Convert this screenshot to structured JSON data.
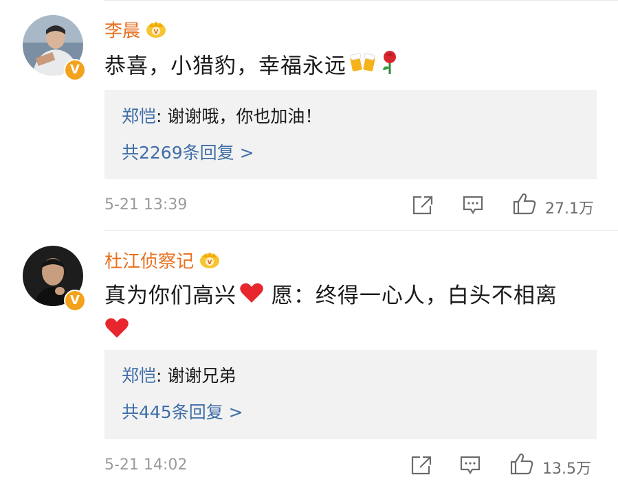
{
  "comments": [
    {
      "username": "李晨",
      "text": "恭喜，小猎豹，幸福永远",
      "emojis": [
        "beer-cheers-icon",
        "rose-icon"
      ],
      "reply": {
        "author": "郑恺",
        "separator": ":",
        "text": " 谢谢哦，你也加油！",
        "count_label": "共2269条回复 >"
      },
      "time": "5-21 13:39",
      "likes": "27.1万"
    },
    {
      "username": "杜江侦察记",
      "text_line1": "真为你们高兴",
      "text_after_heart": " 愿：终得一心人，白头不相离",
      "emojis": [
        "heart-icon",
        "heart-icon"
      ],
      "reply": {
        "author": "郑恺",
        "separator": ":",
        "text": " 谢谢兄弟",
        "count_label": "共445条回复 >"
      },
      "time": "5-21 14:02",
      "likes": "13.5万"
    }
  ],
  "colors": {
    "username": "#e96f1e",
    "reply_author": "#3f6ea8",
    "verified_badge": "#f3a21b",
    "reply_bg": "#f2f2f2",
    "meta": "#9a9a9a"
  }
}
